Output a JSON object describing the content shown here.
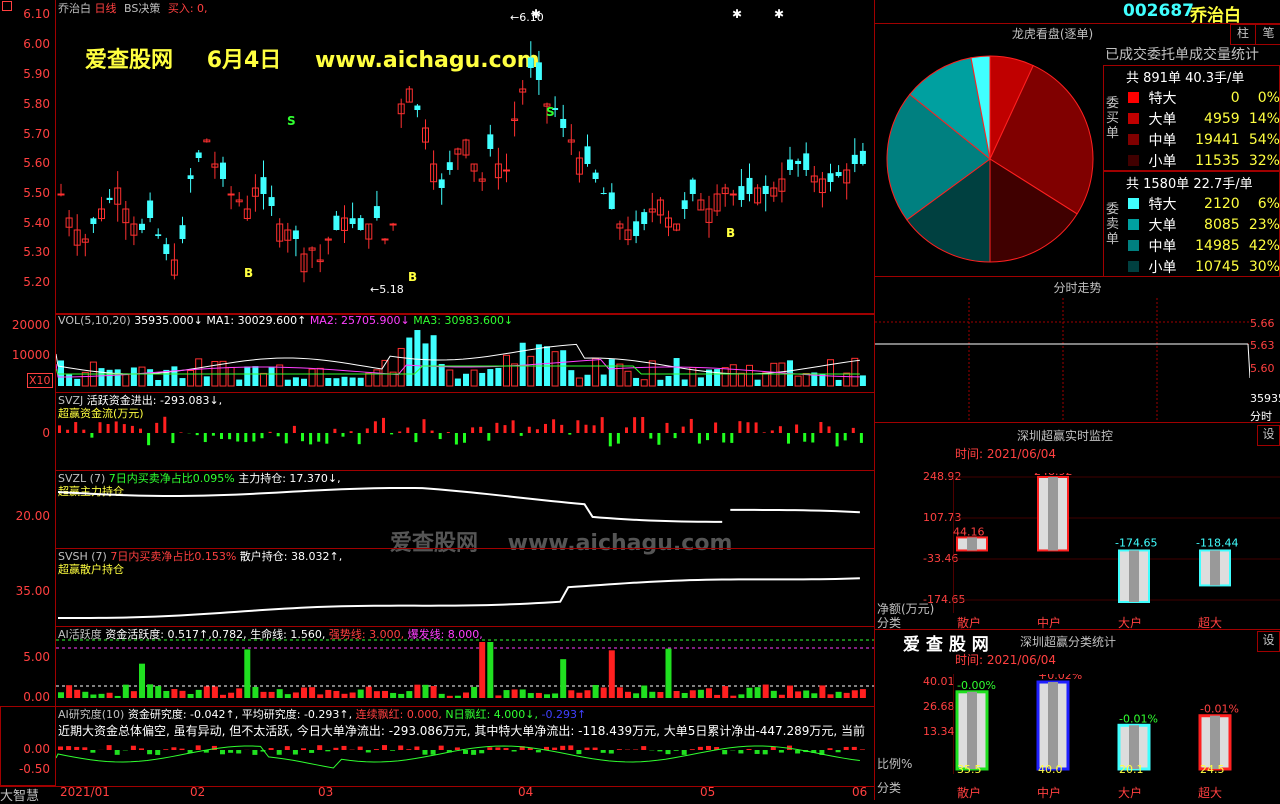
{
  "stock": {
    "code": "002687",
    "name": "乔治白"
  },
  "chart_header": {
    "name": "乔治白",
    "period": "日线",
    "indicator": "BS决策",
    "buy_label": "买入: 0,"
  },
  "watermark": {
    "site": "爱查股网",
    "date": "6月4日",
    "url": "www.aichagu.com",
    "faded": "爱查股网　 www.aichagu.com"
  },
  "price_axis": [
    "6.10",
    "6.00",
    "5.90",
    "5.80",
    "5.70",
    "5.60",
    "5.50",
    "5.40",
    "5.30",
    "5.20"
  ],
  "markers": {
    "high": "6.10",
    "low": "5.18",
    "buy": "B",
    "sell": "S"
  },
  "vol_panel": {
    "title": "VOL(5,10,20)",
    "v": "35935.000↓",
    "ma1": "MA1: 30029.600↑",
    "ma2": "MA2: 25705.900↓",
    "ma3": "MA3: 30983.600↓",
    "axis": [
      "20000",
      "10000"
    ],
    "unit": "X10"
  },
  "svzj_panel": {
    "name": "SVZJ",
    "title": "活跃资金进出: -293.083↓,",
    "sub": "超赢资金流(万元)",
    "axis": [
      "0"
    ]
  },
  "svzl_panel": {
    "name": "SVZL (7)",
    "ratio": "7日内买卖净占比0.095%",
    "holding": "主力持仓: 17.370↓,",
    "sub": "超赢主力持仓",
    "axis": [
      "20.00"
    ]
  },
  "svsh_panel": {
    "name": "SVSH (7)",
    "ratio": "7日内买卖净占比0.153%",
    "holding": "散户持仓: 38.032↑,",
    "sub": "超赢散户持仓",
    "axis": [
      "35.00"
    ]
  },
  "ai_panel": {
    "title": "AI活跃度",
    "a": "资金活跃度: 0.517↑,0.782,",
    "b": "生命线: 1.560,",
    "c": "强势线: 3.000,",
    "d": "爆发线: 8.000,",
    "axis": [
      "5.00",
      "0.00"
    ]
  },
  "ai_research": {
    "title": "AI研究度(10)",
    "a": "资金研究度: -0.042↑,",
    "b": "平均研究度: -0.293↑,",
    "c": "连续飘红: 0.000,",
    "d": "N日飘红: 4.000↓,",
    "e": "-0.293↑",
    "comment": "近期大资金总体偏空, 虽有异动, 但不太活跃, 今日大单净流出: -293.086万元, 其中特大单净流出: -118.439万元, 大单5日累计净出-447.289万元, 当前",
    "axis": [
      "0.00",
      "-0.50"
    ]
  },
  "left_bottom": {
    "brand": "大智慧"
  },
  "dates": [
    "2021/01",
    "02",
    "03",
    "04",
    "05",
    "06"
  ],
  "right_top": {
    "code": "002687",
    "name": "乔治白",
    "btn1": "柱",
    "btn2": "笔"
  },
  "longhu": {
    "title": "龙虎看盘(逐单)",
    "subtitle": "已成交委托单成交量统计",
    "buy_label": "委买单",
    "sell_label": "委卖单",
    "buy_total": "共 891单 40.3手/单",
    "sell_total": "共 1580单 22.7手/单",
    "buy_rows": [
      {
        "label": "特大",
        "vol": "0",
        "pct": "0%",
        "color": "#ff0000"
      },
      {
        "label": "大单",
        "vol": "4959",
        "pct": "14%",
        "color": "#c00000"
      },
      {
        "label": "中单",
        "vol": "19441",
        "pct": "54%",
        "color": "#800000"
      },
      {
        "label": "小单",
        "vol": "11535",
        "pct": "32%",
        "color": "#400000"
      }
    ],
    "sell_rows": [
      {
        "label": "特大",
        "vol": "2120",
        "pct": "6%",
        "color": "#40ffff"
      },
      {
        "label": "大单",
        "vol": "8085",
        "pct": "23%",
        "color": "#00a0a0"
      },
      {
        "label": "中单",
        "vol": "14985",
        "pct": "42%",
        "color": "#008080"
      },
      {
        "label": "小单",
        "vol": "10745",
        "pct": "30%",
        "color": "#004040"
      }
    ]
  },
  "minute": {
    "title": "分时走势",
    "axis": [
      "5.66",
      "5.63",
      "5.60"
    ],
    "vol": "35935",
    "label": "分时"
  },
  "monitor": {
    "title": "深圳超赢实时监控",
    "btn": "设",
    "time": "时间: 2021/06/04",
    "axis": [
      "248.92",
      "107.73",
      "-33.46",
      "-174.65"
    ],
    "unit": "净额(万元)",
    "cat_label": "分类",
    "categories": [
      "散户",
      "中户",
      "大户",
      "超大"
    ],
    "values_text": [
      "44.16",
      "248.92",
      "-174.65",
      "-118.44"
    ]
  },
  "classify": {
    "brand": "爱 查 股 网",
    "title": "深圳超赢分类统计",
    "btn": "设",
    "time": "时间: 2021/06/04",
    "axis": [
      "40.01",
      "26.68",
      "13.34"
    ],
    "unit": "比例%",
    "cat_label": "分类",
    "categories": [
      "散户",
      "中户",
      "大户",
      "超大"
    ],
    "changes": [
      "-0.00%",
      "+0.02%",
      "-0.01%",
      "-0.01%"
    ],
    "values_text": [
      "35.5",
      "40.0",
      "20.1",
      "24.5"
    ]
  },
  "chart_data": [
    {
      "type": "pie",
      "title": "委买单",
      "categories": [
        "特大",
        "大单",
        "中单",
        "小单"
      ],
      "values": [
        0,
        4959,
        19441,
        11535
      ]
    },
    {
      "type": "pie",
      "title": "委卖单",
      "categories": [
        "特大",
        "大单",
        "中单",
        "小单"
      ],
      "values": [
        2120,
        8085,
        14985,
        10745
      ]
    },
    {
      "type": "bar",
      "title": "深圳超赢实时监控",
      "categories": [
        "散户",
        "中户",
        "大户",
        "超大"
      ],
      "values": [
        44.16,
        248.92,
        -174.65,
        -118.44
      ],
      "ylim": [
        -174.65,
        248.92
      ]
    },
    {
      "type": "bar",
      "title": "深圳超赢分类统计",
      "categories": [
        "散户",
        "中户",
        "大户",
        "超大"
      ],
      "values": [
        35.5,
        40.0,
        20.1,
        24.5
      ],
      "ylim": [
        0,
        40.01
      ]
    }
  ]
}
